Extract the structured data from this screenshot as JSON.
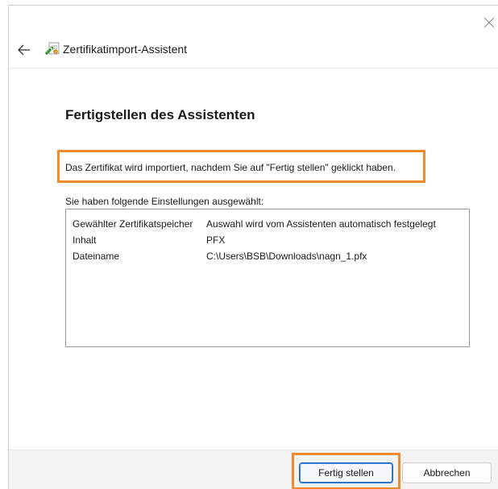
{
  "window": {
    "title": "Zertifikatimport-Assistent"
  },
  "page": {
    "heading": "Fertigstellen des Assistenten",
    "info_text": "Das Zertifikat wird importiert, nachdem Sie auf \"Fertig stellen\" geklickt haben.",
    "settings_label": "Sie haben folgende Einstellungen ausgewählt:"
  },
  "settings": [
    {
      "key": "Gewählter Zertifikatspeicher",
      "value": "Auswahl wird vom Assistenten automatisch festgelegt"
    },
    {
      "key": "Inhalt",
      "value": "PFX"
    },
    {
      "key": "Dateiname",
      "value": "C:\\Users\\BSB\\Downloads\\nagn_1.pfx"
    }
  ],
  "buttons": {
    "finish_label": "Fertig stellen",
    "cancel_label": "Abbrechen"
  },
  "icons": {
    "close": "close-icon",
    "back": "back-arrow-icon",
    "app": "certificate-icon"
  },
  "colors": {
    "highlight": "#f08a2c",
    "primary_button_border": "#1a66c2"
  }
}
